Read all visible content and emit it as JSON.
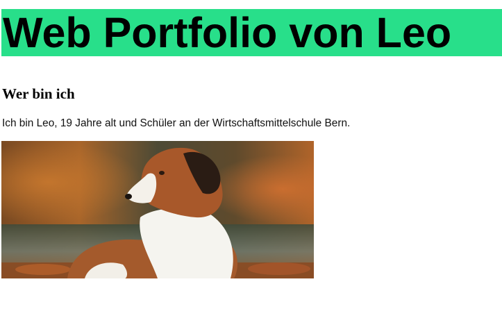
{
  "header": {
    "title": "Web Portfolio von Leo",
    "background_color": "#28df8a"
  },
  "about": {
    "heading": "Wer bin ich",
    "text": "Ich bin Leo, 19 Jahre alt und Schüler an der Wirtschaftsmittelschule Bern."
  },
  "photo": {
    "subject": "dog-photo"
  }
}
